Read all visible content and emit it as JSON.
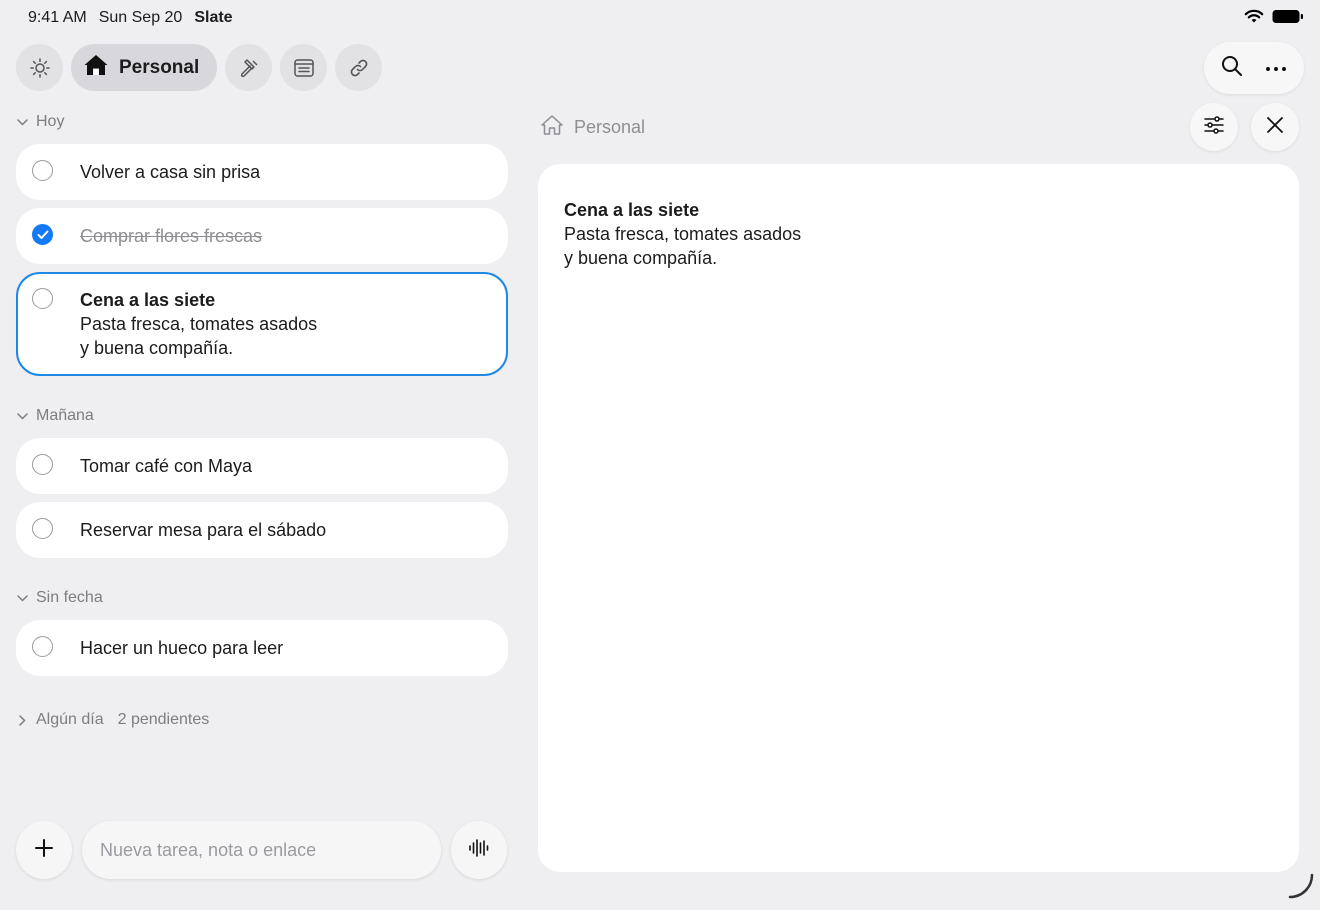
{
  "status": {
    "time": "9:41 AM",
    "date": "Sun Sep 20",
    "app": "Slate"
  },
  "toolbar": {
    "active_label": "Personal"
  },
  "sections": {
    "hoy": {
      "label": "Hoy",
      "tasks": [
        {
          "title": "Volver a casa sin prisa",
          "done": false
        },
        {
          "title": "Comprar flores frescas",
          "done": true
        },
        {
          "title": "Cena a las siete",
          "line1": "Pasta fresca, tomates asados",
          "line2": "y buena compañía.",
          "done": false,
          "selected": true
        }
      ]
    },
    "manana": {
      "label": "Mañana",
      "tasks": [
        {
          "title": "Tomar café con Maya",
          "done": false
        },
        {
          "title": "Reservar mesa para el sábado",
          "done": false
        }
      ]
    },
    "sinfecha": {
      "label": "Sin fecha",
      "tasks": [
        {
          "title": "Hacer un hueco para leer",
          "done": false
        }
      ]
    },
    "algundia": {
      "label": "Algún día",
      "count": "2 pendientes"
    }
  },
  "input": {
    "placeholder": "Nueva tarea, nota o enlace"
  },
  "detail": {
    "breadcrumb": "Personal",
    "title": "Cena a las siete",
    "line1": "Pasta fresca, tomates asados",
    "line2": "y buena compañía."
  },
  "colors": {
    "accent": "#1e88e5",
    "check": "#1479f5",
    "background": "#efeff1"
  }
}
